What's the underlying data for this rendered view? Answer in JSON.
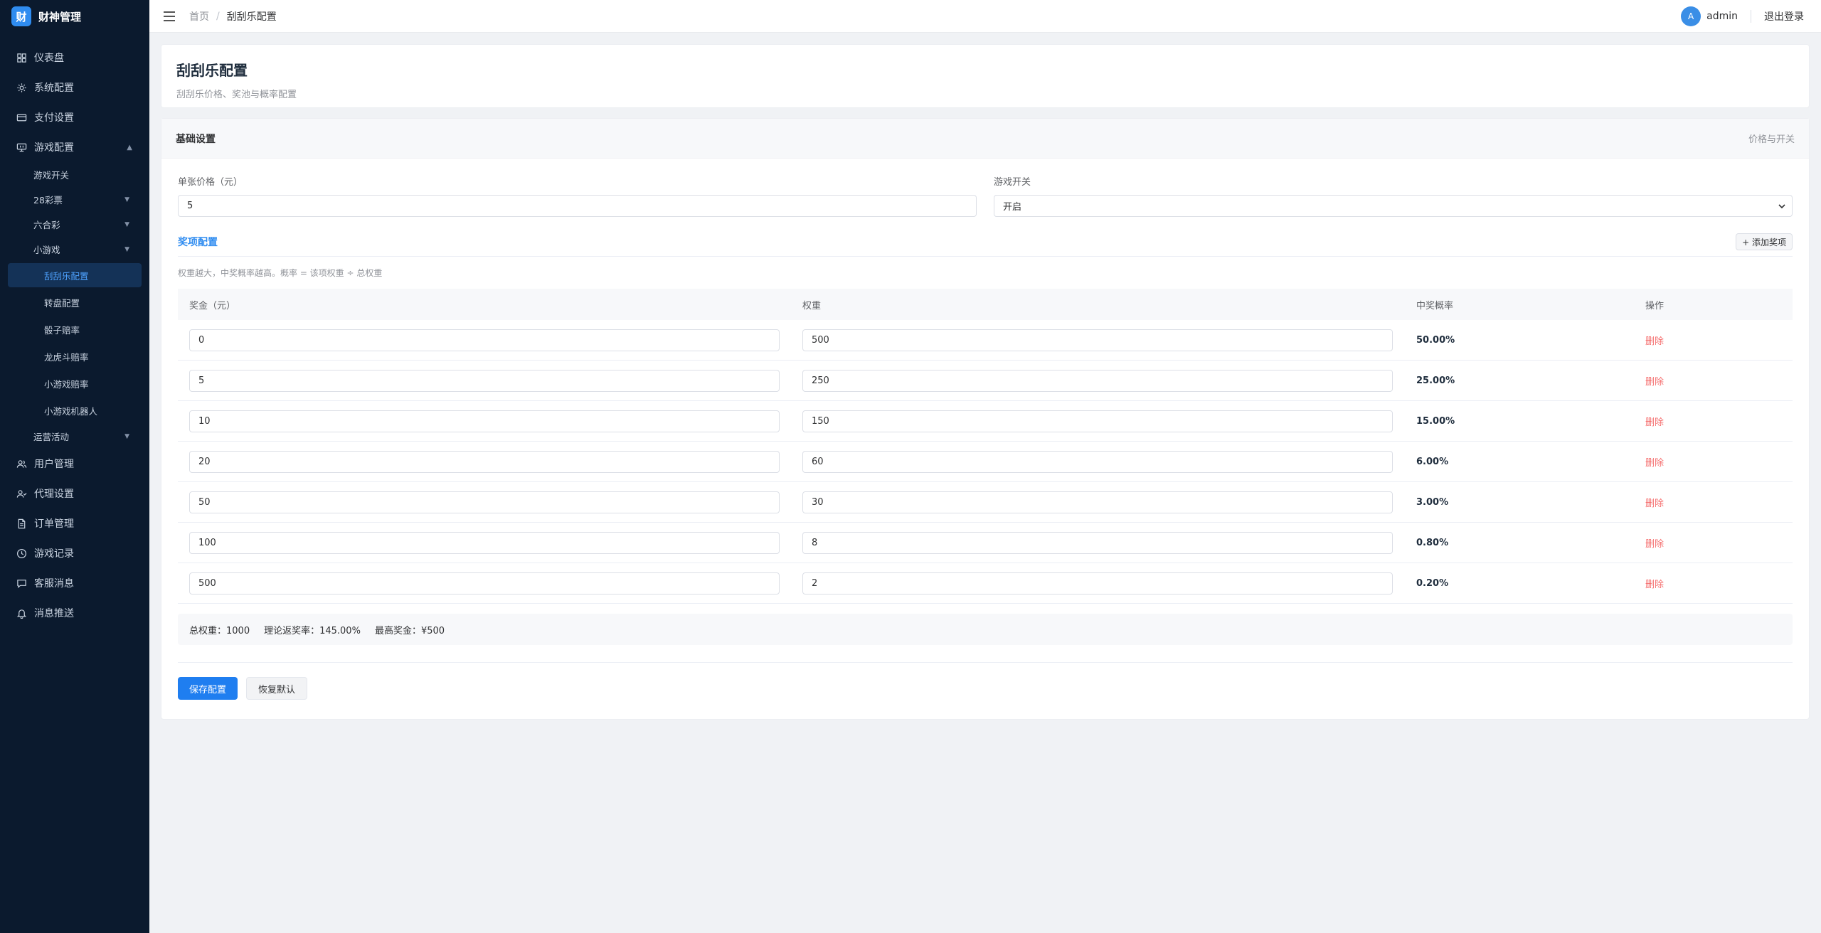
{
  "brand": {
    "logo_char": "财",
    "name": "财神管理"
  },
  "sidebar": {
    "items": [
      {
        "label": "仪表盘",
        "icon": "grid-icon"
      },
      {
        "label": "系统配置",
        "icon": "gear-icon"
      },
      {
        "label": "支付设置",
        "icon": "card-icon"
      },
      {
        "label": "游戏配置",
        "icon": "monitor-icon",
        "arrow": "▲"
      }
    ],
    "game_sub": [
      {
        "label": "游戏开关",
        "arrow": ""
      },
      {
        "label": "28彩票",
        "arrow": "▼"
      },
      {
        "label": "六合彩",
        "arrow": "▼"
      },
      {
        "label": "小游戏",
        "arrow": "▼"
      }
    ],
    "mini_sub": [
      "刮刮乐配置",
      "转盘配置",
      "骰子赔率",
      "龙虎斗赔率",
      "小游戏赔率",
      "小游戏机器人"
    ],
    "ops": {
      "label": "运营活动",
      "arrow": "▼"
    },
    "items_bottom": [
      {
        "label": "用户管理",
        "icon": "users-icon"
      },
      {
        "label": "代理设置",
        "icon": "agent-icon"
      },
      {
        "label": "订单管理",
        "icon": "document-icon"
      },
      {
        "label": "游戏记录",
        "icon": "clock-icon"
      },
      {
        "label": "客服消息",
        "icon": "chat-icon"
      },
      {
        "label": "消息推送",
        "icon": "bell-icon"
      }
    ]
  },
  "topbar": {
    "breadcrumb_home": "首页",
    "breadcrumb_sep": "/",
    "breadcrumb_current": "刮刮乐配置",
    "avatar_char": "A",
    "username": "admin",
    "logout": "退出登录"
  },
  "page": {
    "title": "刮刮乐配置",
    "subtitle": "刮刮乐价格、奖池与概率配置"
  },
  "basic": {
    "title": "基础设置",
    "extra": "价格与开关",
    "price_label": "单张价格（元）",
    "price_value": "5",
    "switch_label": "游戏开关",
    "switch_value": "开启"
  },
  "prizes": {
    "title": "奖项配置",
    "add_label": "+ 添加奖项",
    "hint": "权重越大，中奖概率越高。概率 = 该项权重 ÷ 总权重",
    "headers": [
      "奖金（元）",
      "权重",
      "中奖概率",
      "操作"
    ],
    "rows": [
      {
        "amount": "0",
        "weight": "500",
        "prob": "50.00%",
        "action": "删除"
      },
      {
        "amount": "5",
        "weight": "250",
        "prob": "25.00%",
        "action": "删除"
      },
      {
        "amount": "10",
        "weight": "150",
        "prob": "15.00%",
        "action": "删除"
      },
      {
        "amount": "20",
        "weight": "60",
        "prob": "6.00%",
        "action": "删除"
      },
      {
        "amount": "50",
        "weight": "30",
        "prob": "3.00%",
        "action": "删除"
      },
      {
        "amount": "100",
        "weight": "8",
        "prob": "0.80%",
        "action": "删除"
      },
      {
        "amount": "500",
        "weight": "2",
        "prob": "0.20%",
        "action": "删除"
      }
    ]
  },
  "summary": {
    "total_weight": "总权重：1000",
    "rtp": "理论返奖率：145.00%",
    "max_prize": "最高奖金：¥500"
  },
  "actions": {
    "save": "保存配置",
    "reset": "恢复默认"
  },
  "colors": {
    "sidebar_bg": "#0b1a2e",
    "primary": "#1f7ef0",
    "danger": "#f56c6c",
    "active_text": "#4ea2ff"
  }
}
